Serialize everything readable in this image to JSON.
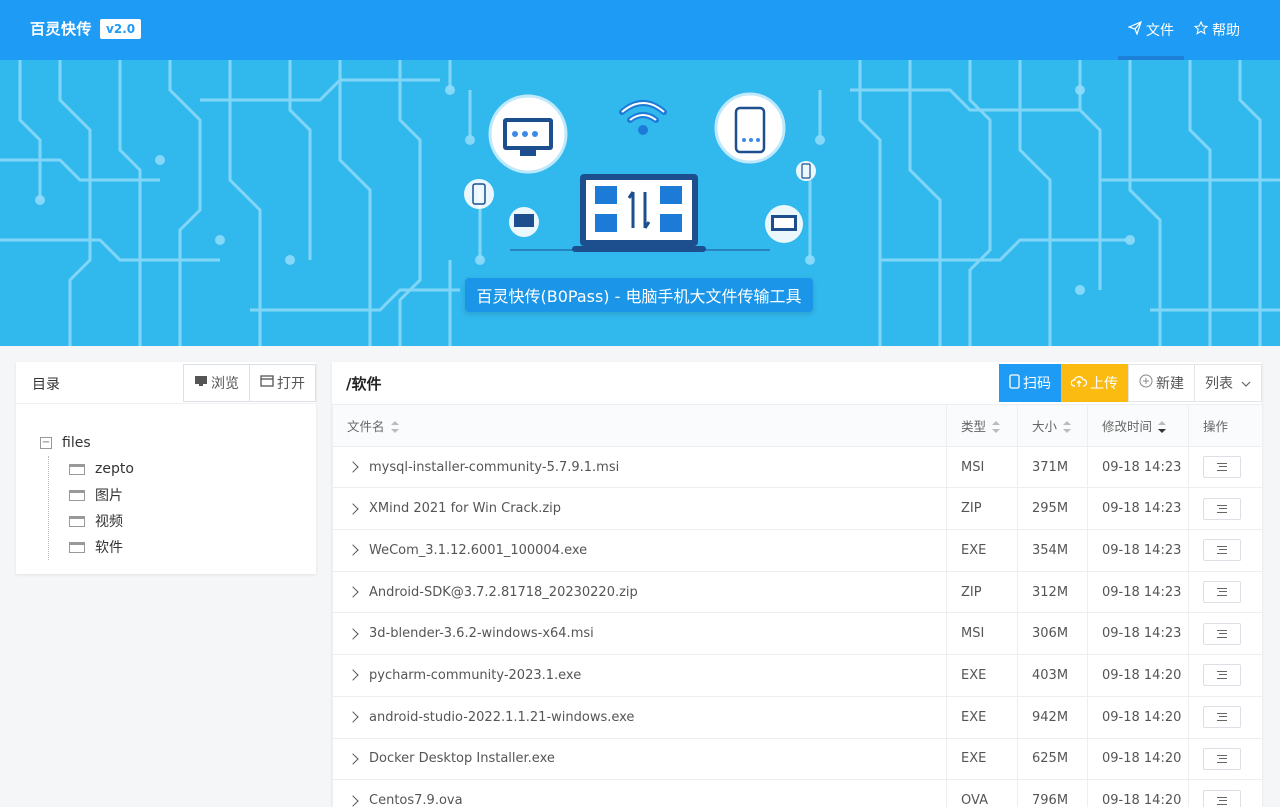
{
  "header": {
    "brand": "百灵快传",
    "version": "v2.0",
    "nav": [
      {
        "label": "文件",
        "icon": "send-icon",
        "active": true
      },
      {
        "label": "帮助",
        "icon": "star-icon",
        "active": false
      }
    ],
    "bg_color": "#1e9bf5"
  },
  "banner": {
    "title": "百灵快传(B0Pass) - 电脑手机大文件传输工具",
    "bg_color": "#31b9ee"
  },
  "directory": {
    "title": "目录",
    "browse_label": "浏览",
    "open_label": "打开",
    "root": "files",
    "children": [
      "zepto",
      "图片",
      "视频",
      "软件"
    ]
  },
  "files": {
    "path": "/软件",
    "toolbar": {
      "scan_label": "扫码",
      "upload_label": "上传",
      "new_label": "新建",
      "view_label": "列表"
    },
    "columns": {
      "name": "文件名",
      "type": "类型",
      "size": "大小",
      "modified": "修改时间",
      "actions": "操作"
    },
    "rows": [
      {
        "name": "mysql-installer-community-5.7.9.1.msi",
        "type": "MSI",
        "size": "371M",
        "modified": "09-18 14:23"
      },
      {
        "name": "XMind 2021 for Win Crack.zip",
        "type": "ZIP",
        "size": "295M",
        "modified": "09-18 14:23"
      },
      {
        "name": "WeCom_3.1.12.6001_100004.exe",
        "type": "EXE",
        "size": "354M",
        "modified": "09-18 14:23"
      },
      {
        "name": "Android-SDK@3.7.2.81718_20230220.zip",
        "type": "ZIP",
        "size": "312M",
        "modified": "09-18 14:23"
      },
      {
        "name": "3d-blender-3.6.2-windows-x64.msi",
        "type": "MSI",
        "size": "306M",
        "modified": "09-18 14:23"
      },
      {
        "name": "pycharm-community-2023.1.exe",
        "type": "EXE",
        "size": "403M",
        "modified": "09-18 14:20"
      },
      {
        "name": "android-studio-2022.1.1.21-windows.exe",
        "type": "EXE",
        "size": "942M",
        "modified": "09-18 14:20"
      },
      {
        "name": "Docker Desktop Installer.exe",
        "type": "EXE",
        "size": "625M",
        "modified": "09-18 14:20"
      },
      {
        "name": "Centos7.9.ova",
        "type": "OVA",
        "size": "796M",
        "modified": "09-18 14:20"
      }
    ]
  }
}
